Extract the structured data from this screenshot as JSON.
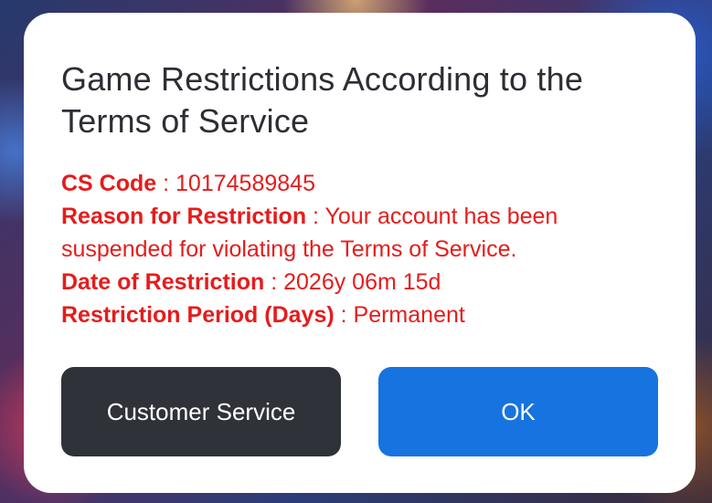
{
  "dialog": {
    "title": "Game Restrictions According to the Terms of Service",
    "details": [
      {
        "label": "CS Code",
        "value": "10174589845"
      },
      {
        "label": "Reason for Restriction",
        "value": "Your account has been suspended for violating the Terms of Service."
      },
      {
        "label": "Date of Restriction",
        "value": "2026y 06m 15d"
      },
      {
        "label": "Restriction Period (Days)",
        "value": "Permanent"
      }
    ],
    "buttons": {
      "customer_service": "Customer Service",
      "ok": "OK"
    }
  },
  "colors": {
    "detail_text": "#e51c1c",
    "title_text": "#2c2e34",
    "secondary_button": "#30323a",
    "primary_button": "#1673e0",
    "dialog_background": "#ffffff"
  }
}
